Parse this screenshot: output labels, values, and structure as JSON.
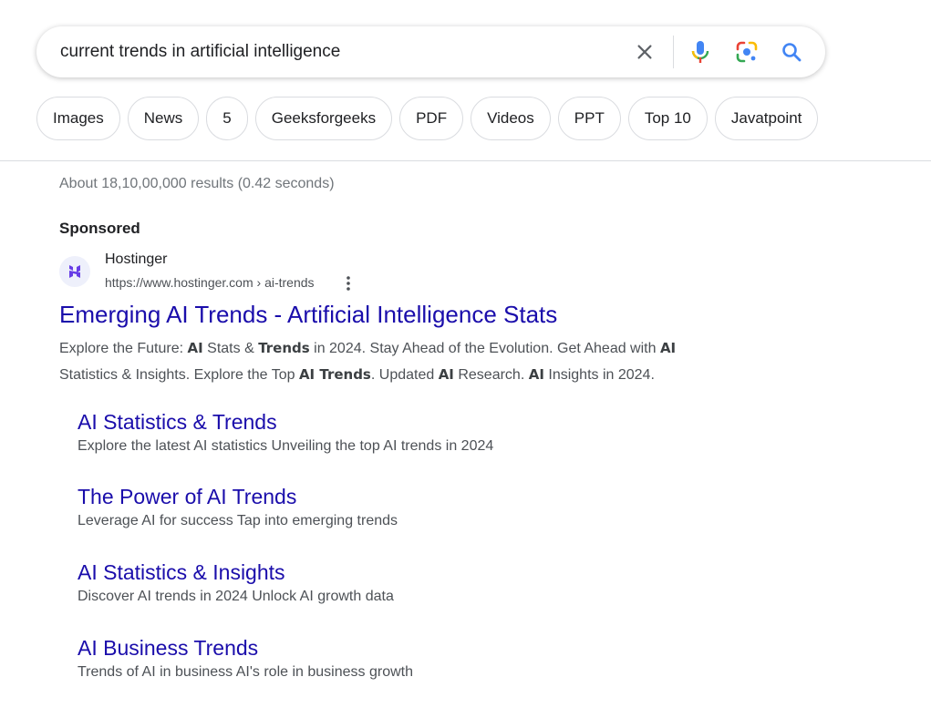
{
  "search": {
    "query": "current trends in artificial intelligence"
  },
  "chips": [
    "Images",
    "News",
    "5",
    "Geeksforgeeks",
    "PDF",
    "Videos",
    "PPT",
    "Top 10",
    "Javatpoint"
  ],
  "result_stats": "About 18,10,00,000 results (0.42 seconds)",
  "ad": {
    "sponsored_label": "Sponsored",
    "site_name": "Hostinger",
    "url": "https://www.hostinger.com › ai-trends",
    "title": "Emerging AI Trends - Artificial Intelligence Stats",
    "description_line1": [
      {
        "t": "Explore the Future: ",
        "b": false
      },
      {
        "t": "AI",
        "b": true
      },
      {
        "t": " Stats & ",
        "b": false
      },
      {
        "t": "Trends",
        "b": true
      },
      {
        "t": " in 2024. Stay Ahead of the Evolution. Get Ahead with ",
        "b": false
      },
      {
        "t": "AI",
        "b": true
      }
    ],
    "description_line2": [
      {
        "t": "Statistics & Insights. Explore the Top ",
        "b": false
      },
      {
        "t": "AI Trends",
        "b": true
      },
      {
        "t": ". Updated ",
        "b": false
      },
      {
        "t": "AI",
        "b": true
      },
      {
        "t": " Research. ",
        "b": false
      },
      {
        "t": "AI",
        "b": true
      },
      {
        "t": " Insights in 2024.",
        "b": false
      }
    ],
    "sitelinks": [
      {
        "title": "AI Statistics & Trends",
        "desc": "Explore the latest AI statistics Unveiling the top AI trends in 2024"
      },
      {
        "title": "The Power of AI Trends",
        "desc": "Leverage AI for success Tap into emerging trends"
      },
      {
        "title": "AI Statistics & Insights",
        "desc": "Discover AI trends in 2024 Unlock AI growth data"
      },
      {
        "title": "AI Business Trends",
        "desc": "Trends of AI in business AI's role in business growth"
      }
    ]
  },
  "colors": {
    "link": "#1a0dab",
    "text": "#202124",
    "snippet": "#4d5156",
    "muted": "#70757a",
    "google_blue": "#4285f4",
    "google_red": "#ea4335",
    "google_yellow": "#fbbc04",
    "google_green": "#34a853",
    "hostinger_purple": "#673de6"
  }
}
